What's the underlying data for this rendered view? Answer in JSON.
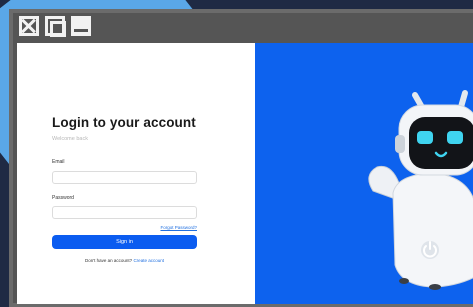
{
  "window": {
    "controls": [
      "close-icon",
      "maximize-icon",
      "minimize-icon"
    ]
  },
  "login": {
    "title": "Login to your account",
    "subtitle": "Welcome back",
    "email_label": "Email",
    "email_value": "",
    "password_label": "Password",
    "password_value": "",
    "forgot_link": "Forgot Password?",
    "signin_button": "Sign in",
    "footer_text": "Don't have an account?",
    "create_link": "Create account"
  },
  "illustration": {
    "subject": "robot-mascot",
    "bg_color": "#0d62ee",
    "robot_eye_color": "#3fd4f0"
  }
}
